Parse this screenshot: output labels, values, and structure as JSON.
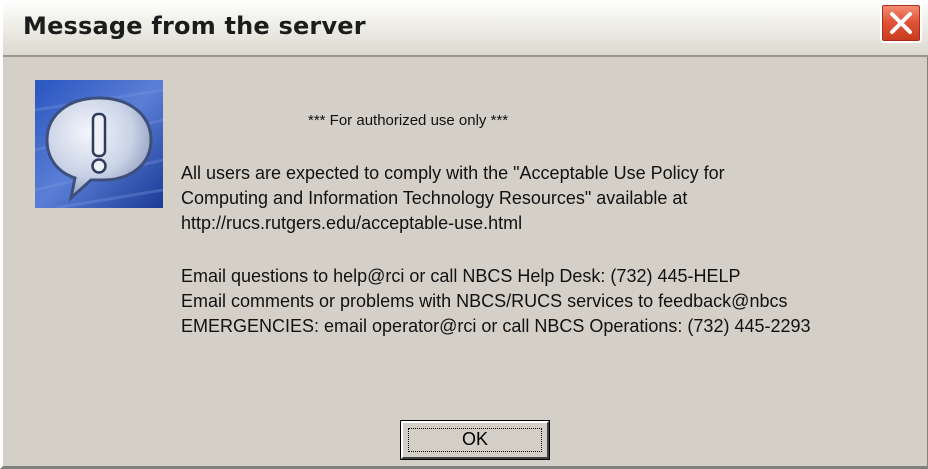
{
  "window": {
    "title": "Message from the server",
    "close_glyph": "✕"
  },
  "icon": {
    "name": "exclamation-speech-bubble-icon",
    "bg_colors": [
      "#1b3f9e",
      "#6f8fd8"
    ]
  },
  "message": {
    "headline": "*** For authorized use only ***",
    "policy_lines": [
      "All users are expected to comply with the \"Acceptable Use Policy for",
      "Computing and Information Technology Resources\" available at",
      "http://rucs.rutgers.edu/acceptable-use.html"
    ],
    "contact_lines": [
      "Email questions to help@rci or call NBCS Help Desk: (732) 445-HELP",
      "Email comments or problems with NBCS/RUCS services to feedback@nbcs",
      "EMERGENCIES: email operator@rci or call NBCS Operations: (732) 445-2293"
    ]
  },
  "buttons": {
    "ok_label": "OK"
  },
  "colors": {
    "dialog_bg": "#d4d0c8",
    "close_red": "#e0553a"
  }
}
